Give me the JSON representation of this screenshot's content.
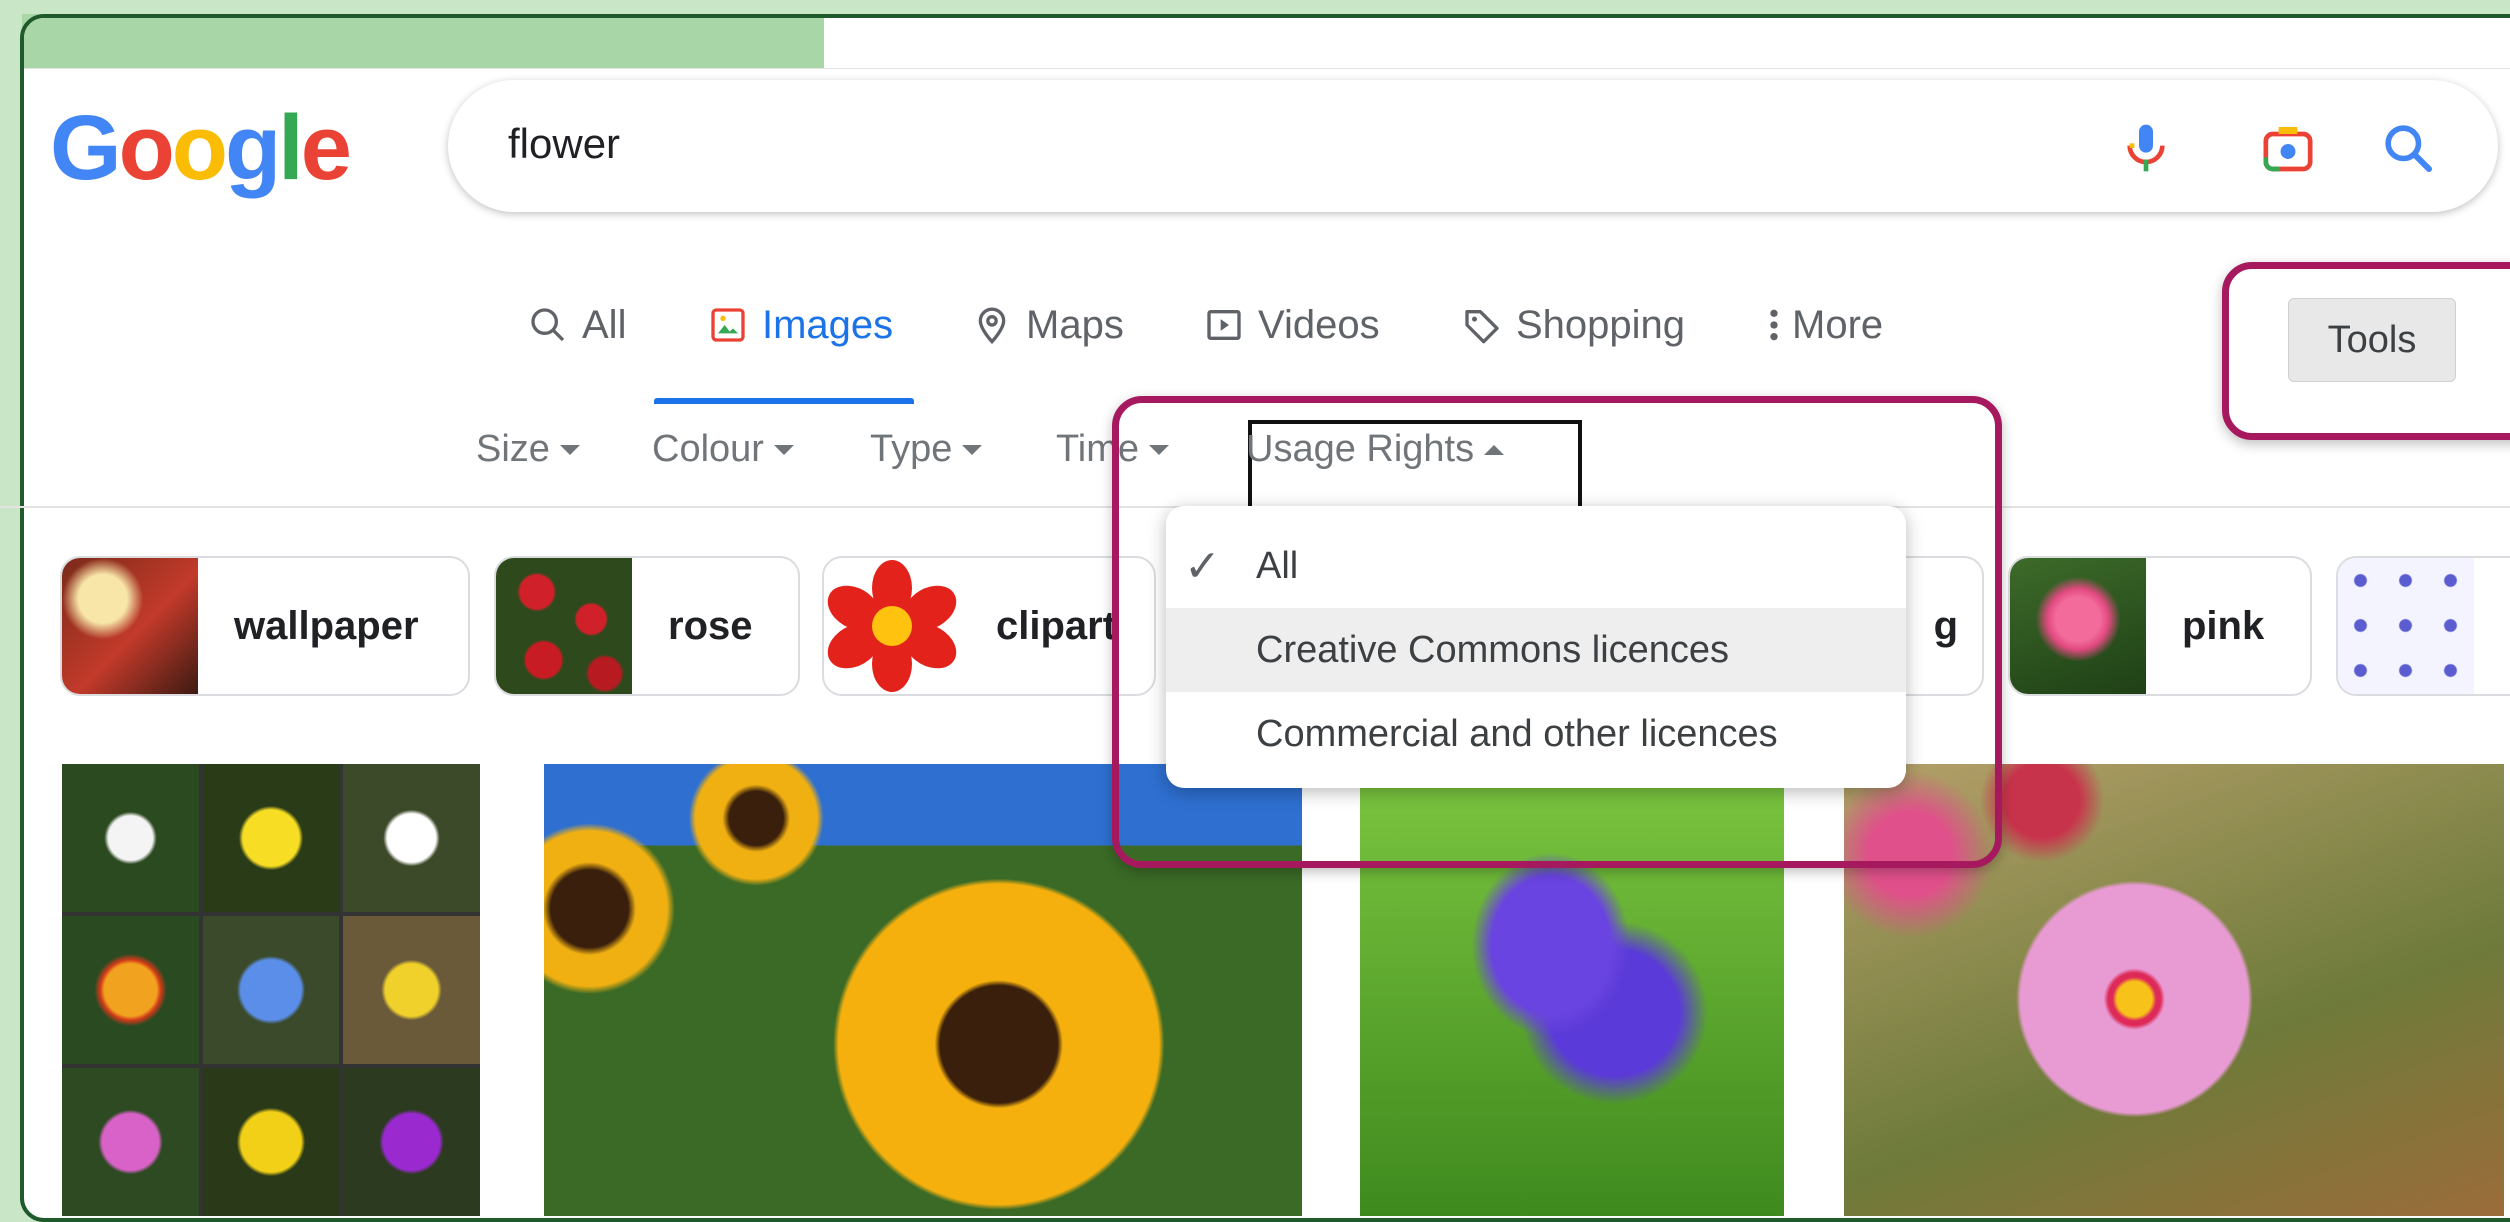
{
  "search": {
    "query": "flower"
  },
  "logo": {
    "letters": [
      "G",
      "o",
      "o",
      "g",
      "l",
      "e"
    ],
    "colors": [
      "#4285F4",
      "#EA4335",
      "#FBBC05",
      "#4285F4",
      "#34A853",
      "#EA4335"
    ]
  },
  "icons": {
    "voice": "microphone-icon",
    "lens": "camera-icon",
    "search": "search-icon"
  },
  "tabs": [
    {
      "label": "All",
      "icon": "search-icon"
    },
    {
      "label": "Images",
      "icon": "image-icon",
      "active": true
    },
    {
      "label": "Maps",
      "icon": "map-pin-icon"
    },
    {
      "label": "Videos",
      "icon": "play-icon"
    },
    {
      "label": "Shopping",
      "icon": "tag-icon"
    },
    {
      "label": "More",
      "icon": "more-vert-icon"
    }
  ],
  "tools_label": "Tools",
  "filters": [
    {
      "label": "Size"
    },
    {
      "label": "Colour"
    },
    {
      "label": "Type"
    },
    {
      "label": "Time"
    },
    {
      "label": "Usage Rights",
      "open": true
    }
  ],
  "chips": [
    {
      "label": "wallpaper"
    },
    {
      "label": "rose"
    },
    {
      "label": "clipart"
    },
    {
      "label": "g"
    },
    {
      "label": "pink"
    }
  ],
  "dropdown": {
    "items": [
      {
        "label": "All",
        "checked": true
      },
      {
        "label": "Creative Commons licences",
        "hover": true
      },
      {
        "label": "Commercial and other licences"
      }
    ]
  },
  "colors": {
    "accent": "#1a73e8",
    "highlight": "#a6195f",
    "frame": "#1e5a2c"
  }
}
